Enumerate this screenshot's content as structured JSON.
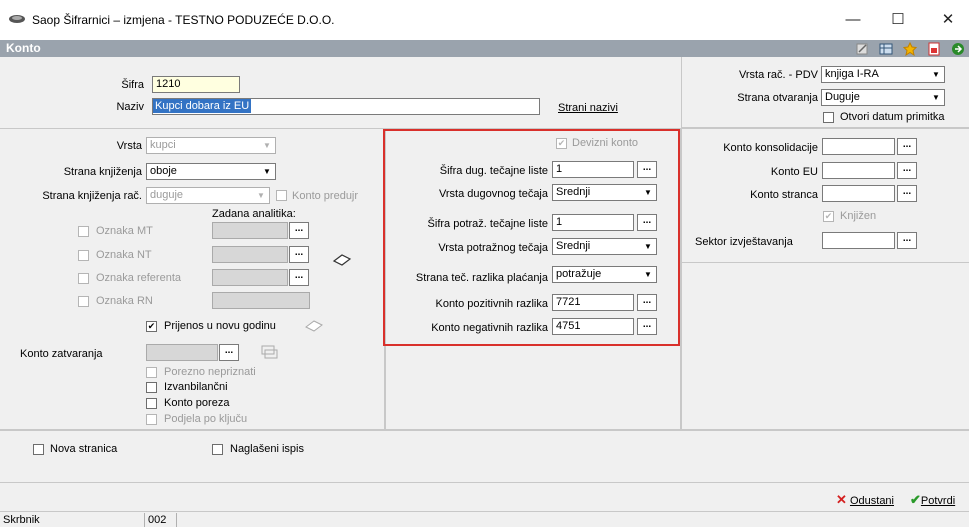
{
  "window": {
    "title": "Saop Šifrarnici – izmjena  - TESTNO PODUZEĆE D.O.O.",
    "min": "—",
    "max": "☐",
    "close": "✕"
  },
  "header": {
    "title": "Konto"
  },
  "top": {
    "sifra_label": "Šifra",
    "sifra_value": "1210",
    "naziv_label": "Naziv",
    "naziv_value": "Kupci dobara iz EU",
    "strani_nazivi": "Strani nazivi",
    "vrsta_rac_pdv_label": "Vrsta rač. - PDV",
    "vrsta_rac_pdv_value": "knjiga I-RA",
    "strana_otvaranja_label": "Strana otvaranja",
    "strana_otvaranja_value": "Duguje",
    "otvori_datum_label": "Otvori datum primitka"
  },
  "left": {
    "vrsta_label": "Vrsta",
    "vrsta_value": "kupci",
    "strana_knjizenja_label": "Strana knjiženja",
    "strana_knjizenja_value": "oboje",
    "strana_knjizenja_rac_label": "Strana knjiženja rač.",
    "strana_knjizenja_rac_value": "duguje",
    "konto_predujma_label": "Konto predujr",
    "zadana_analitika": "Zadana analitika:",
    "oznaka_mt": "Oznaka MT",
    "oznaka_nt": "Oznaka NT",
    "oznaka_referenta": "Oznaka referenta",
    "oznaka_rn": "Oznaka RN",
    "prijenos_label": "Prijenos u novu godinu",
    "konto_zatvaranja_label": "Konto zatvaranja",
    "porezno_nepriznati": "Porezno nepriznati",
    "izvanbilancni": "Izvanbilančni",
    "konto_poreza": "Konto poreza",
    "podjela_po_kljucu": "Podjela po ključu"
  },
  "middle": {
    "devizni_konto": "Devizni konto",
    "sifra_dug_label": "Šifra dug. tečajne liste",
    "sifra_dug_value": "1",
    "vrsta_dug_label": "Vrsta dugovnog tečaja",
    "vrsta_dug_value": "Srednji",
    "sifra_potr_label": "Šifra potraž. tečajne liste",
    "sifra_potr_value": "1",
    "vrsta_potr_label": "Vrsta potražnog tečaja",
    "vrsta_potr_value": "Srednji",
    "strana_tec_label": "Strana teč. razlika plaćanja",
    "strana_tec_value": "potražuje",
    "konto_poz_label": "Konto pozitivnih razlika",
    "konto_poz_value": "7721",
    "konto_neg_label": "Konto negativnih razlika",
    "konto_neg_value": "4751"
  },
  "right": {
    "konto_konsolidacije": "Konto konsolidacije",
    "konto_eu": "Konto EU",
    "konto_stranca": "Konto stranca",
    "knjizen": "Knjižen",
    "sektor": "Sektor izvještavanja"
  },
  "bottom": {
    "nova_stranica": "Nova stranica",
    "naglaseni_ispis": "Naglašeni ispis",
    "odustani": "Odustani",
    "potvrdi": "Potvrdi"
  },
  "status": {
    "skrbnik": "Skrbnik",
    "code": "002"
  },
  "dots": "..."
}
